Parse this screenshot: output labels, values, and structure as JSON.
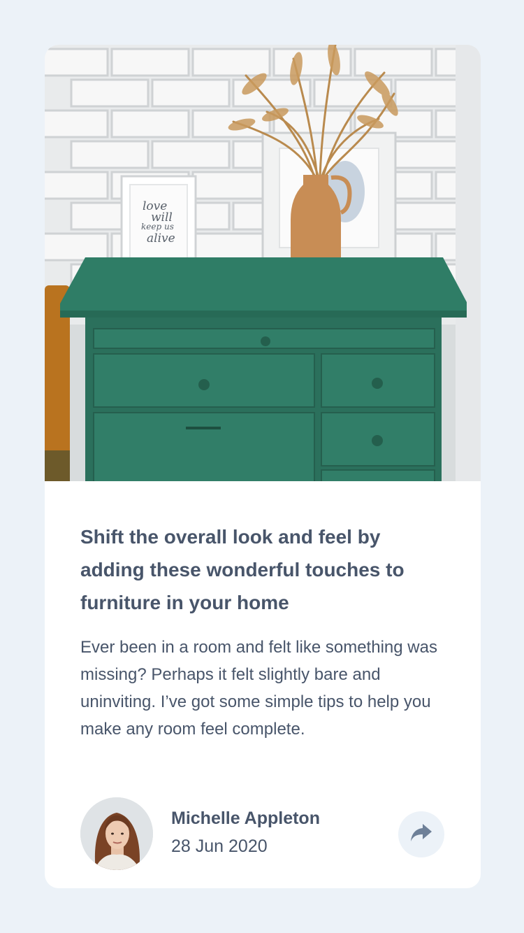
{
  "article": {
    "title": "Shift the overall look and feel by adding these wonderful touches to furniture in your home",
    "excerpt": "Ever been in a room and felt like something was missing? Perhaps it felt slightly bare and uninviting. I’ve got some simple tips to help you make any room feel complete.",
    "image_lettering": "love will keep us alive"
  },
  "author": {
    "name": "Michelle Appleton",
    "date": "28 Jun 2020"
  },
  "icons": {
    "share": "share-icon"
  },
  "colors": {
    "page_background": "#ecf2f8",
    "card_background": "#ffffff",
    "text": "#48556a",
    "share_background": "#ecf2f8",
    "share_icon": "#6e8098",
    "dresser_green": "#2f7d66"
  }
}
